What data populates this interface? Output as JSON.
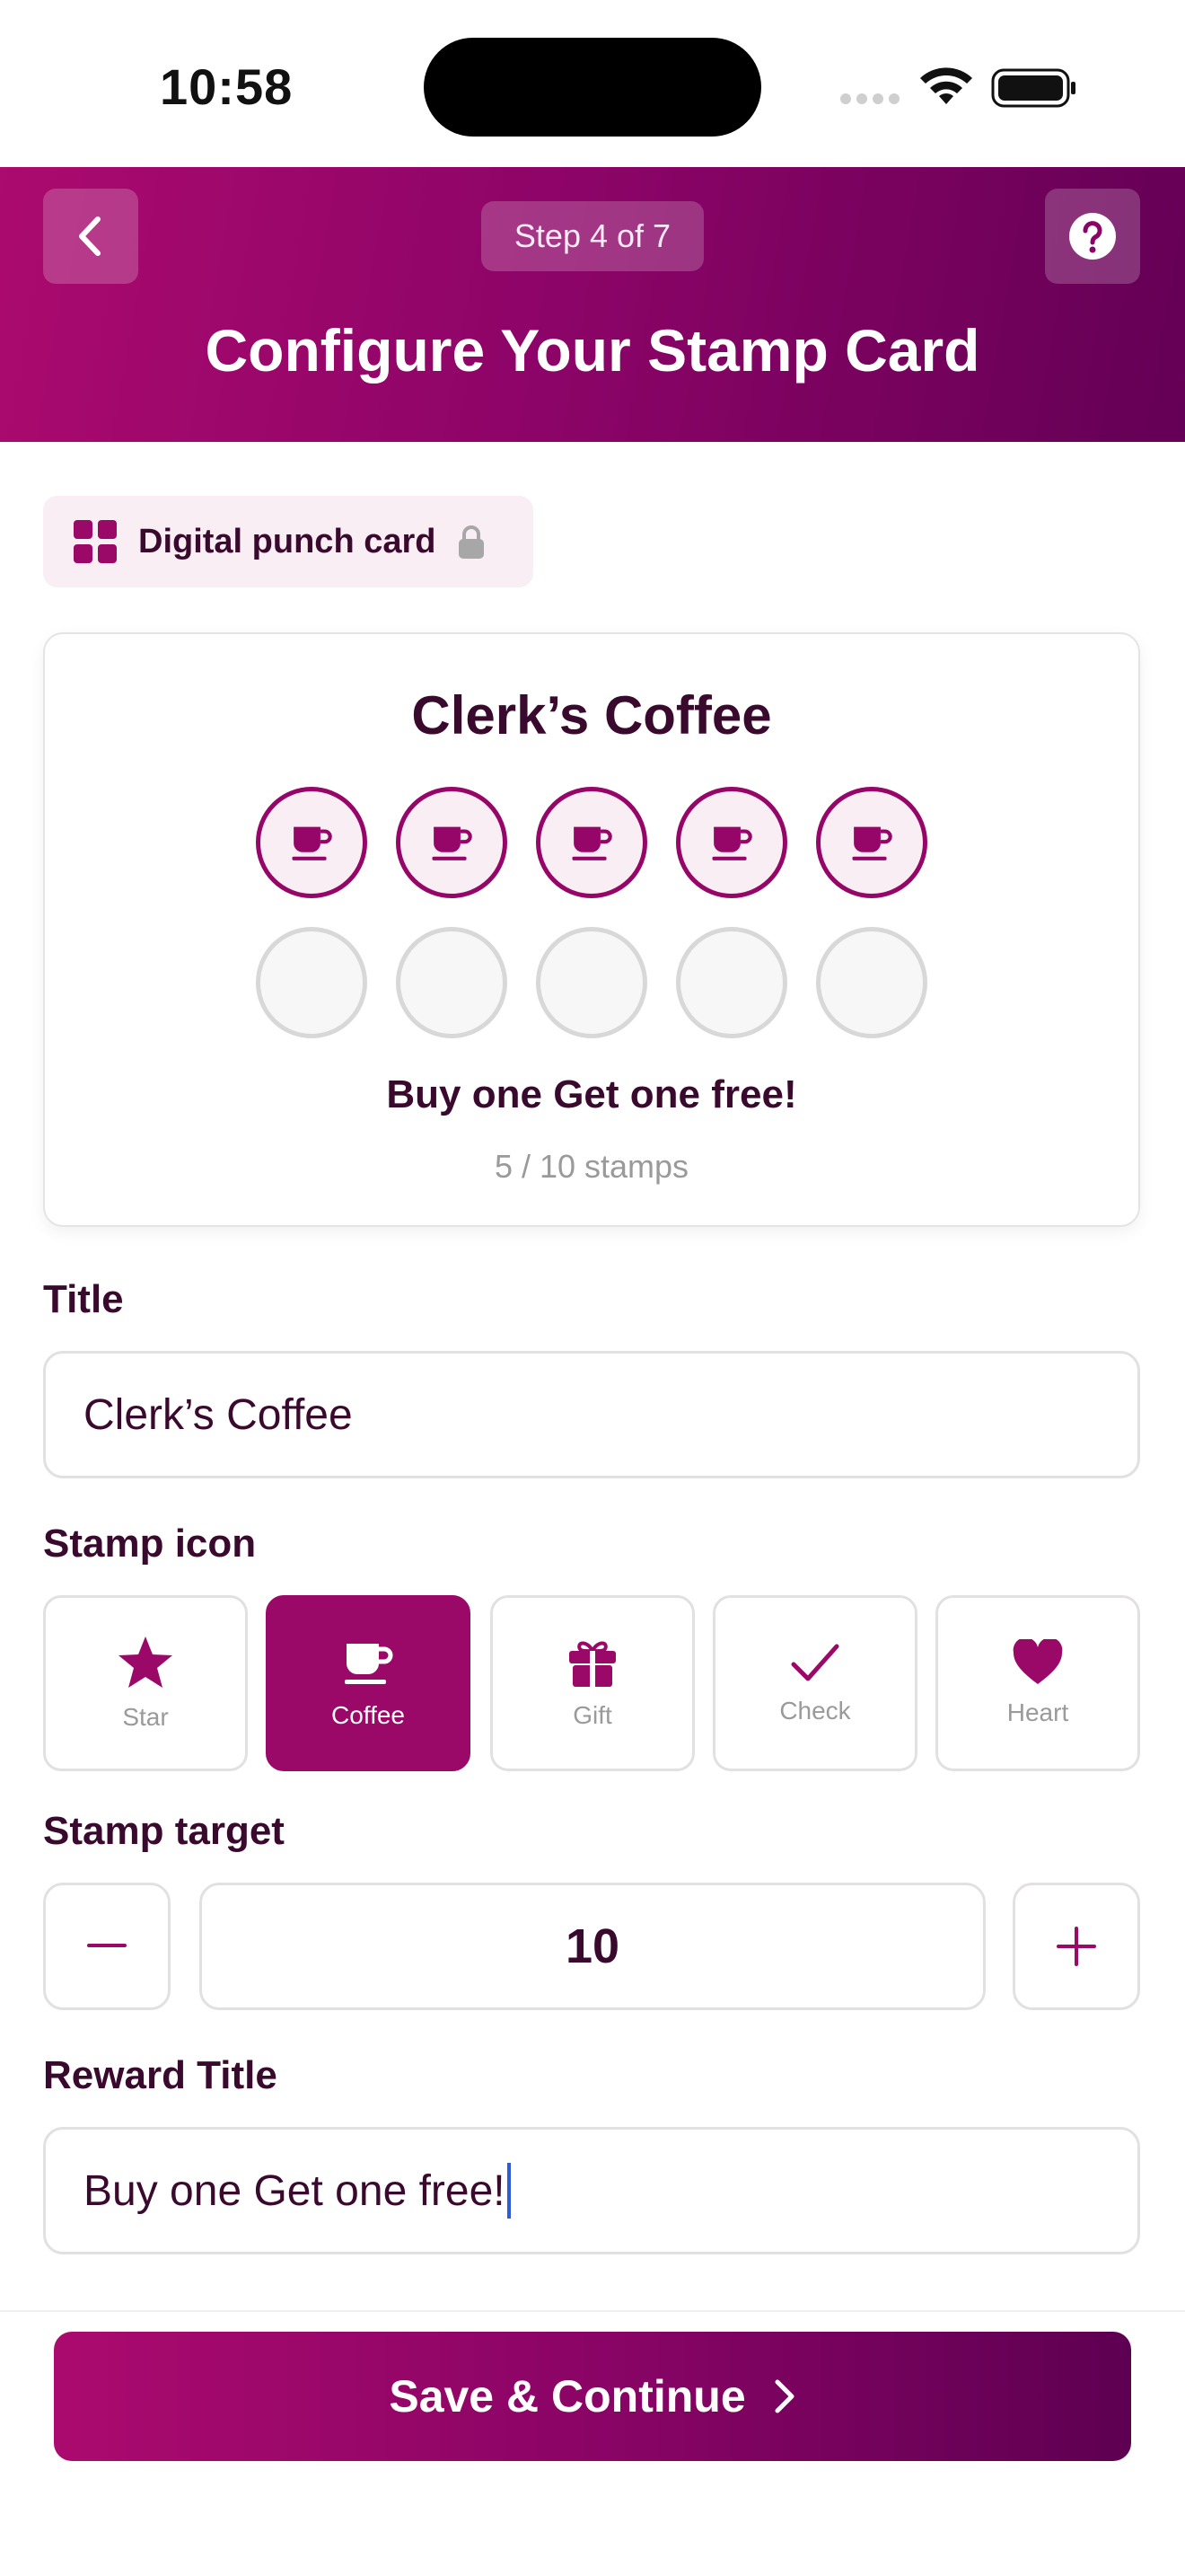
{
  "status_bar": {
    "time": "10:58"
  },
  "header": {
    "step": "Step 4 of 7",
    "title": "Configure Your Stamp Card"
  },
  "badge": {
    "label": "Digital punch card"
  },
  "preview": {
    "title": "Clerk’s Coffee",
    "stamps_filled": 5,
    "stamps_total": 10,
    "reward": "Buy one Get one free!",
    "count_text": "5 / 10 stamps"
  },
  "form": {
    "title_label": "Title",
    "title_value": "Clerk’s Coffee",
    "icon_label": "Stamp icon",
    "icons": [
      {
        "label": "Star",
        "icon": "star-icon"
      },
      {
        "label": "Coffee",
        "icon": "coffee-icon"
      },
      {
        "label": "Gift",
        "icon": "gift-icon"
      },
      {
        "label": "Check",
        "icon": "check-icon"
      },
      {
        "label": "Heart",
        "icon": "heart-icon"
      }
    ],
    "selected_icon": "Coffee",
    "target_label": "Stamp target",
    "target_value": "10",
    "reward_label": "Reward Title",
    "reward_value": "Buy one Get one free!"
  },
  "cta": {
    "label": "Save & Continue"
  },
  "colors": {
    "brand": "#9a0868",
    "brand_dark": "#5e0052",
    "text": "#3a0a2e",
    "muted": "#9a9a9a",
    "caret": "#2f5bd6"
  }
}
